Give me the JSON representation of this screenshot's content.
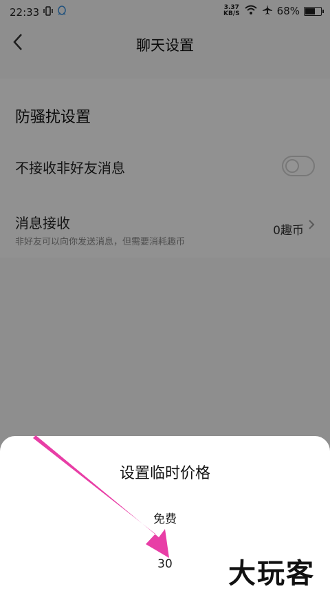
{
  "status_bar": {
    "time": "22:33",
    "speed_value": "3.37",
    "speed_unit": "KB/S",
    "battery": "68%",
    "battery_level": 0.68
  },
  "header": {
    "title": "聊天设置"
  },
  "content": {
    "section_title": "防骚扰设置",
    "row_no_stranger": {
      "label": "不接收非好友消息",
      "enabled": false
    },
    "row_message": {
      "label": "消息接收",
      "subtitle": "非好友可以向你发送消息，但需要消耗趣币",
      "value": "0趣币"
    }
  },
  "sheet": {
    "title": "设置临时价格",
    "options": [
      "免费",
      "30"
    ]
  },
  "watermark": "大玩客",
  "colors": {
    "arrow": "#e83ea6",
    "overlay": "rgba(0,0,0,0.42)"
  }
}
